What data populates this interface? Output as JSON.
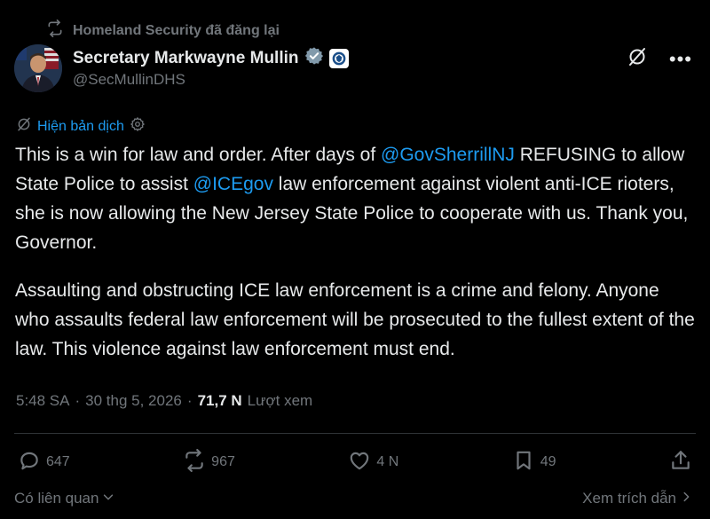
{
  "repost": {
    "text": "Homeland Security đã đăng lại"
  },
  "author": {
    "name": "Secretary Markwayne Mullin",
    "handle": "@SecMullinDHS"
  },
  "translate": {
    "label": "Hiện bản dịch"
  },
  "tweet": {
    "p1_a": "This is a win for law and order. After days of ",
    "p1_mention1": "@GovSherrillNJ",
    "p1_b": " REFUSING to allow State Police to assist ",
    "p1_mention2": "@ICEgov",
    "p1_c": " law enforcement against violent anti-ICE rioters, she is now allowing the New Jersey State Police to cooperate with us. Thank you, Governor.",
    "p2": "Assaulting and obstructing ICE law enforcement is a crime and felony. Anyone who assaults federal law enforcement will be prosecuted to the fullest extent of the law. This violence against law enforcement must end."
  },
  "meta": {
    "time": "5:48 SA",
    "sep1": "·",
    "date": "30 thg 5, 2026",
    "sep2": "·",
    "views_count": "71,7 N",
    "views_label": "Lượt xem"
  },
  "actions": {
    "replies": "647",
    "reposts": "967",
    "likes": "4 N",
    "bookmarks": "49"
  },
  "footer": {
    "related": "Có liên quan",
    "quotes": "Xem trích dẫn"
  },
  "colors": {
    "accent": "#1d9bf0",
    "muted": "#71767b",
    "text": "#e7e9ea",
    "background": "#000000"
  }
}
